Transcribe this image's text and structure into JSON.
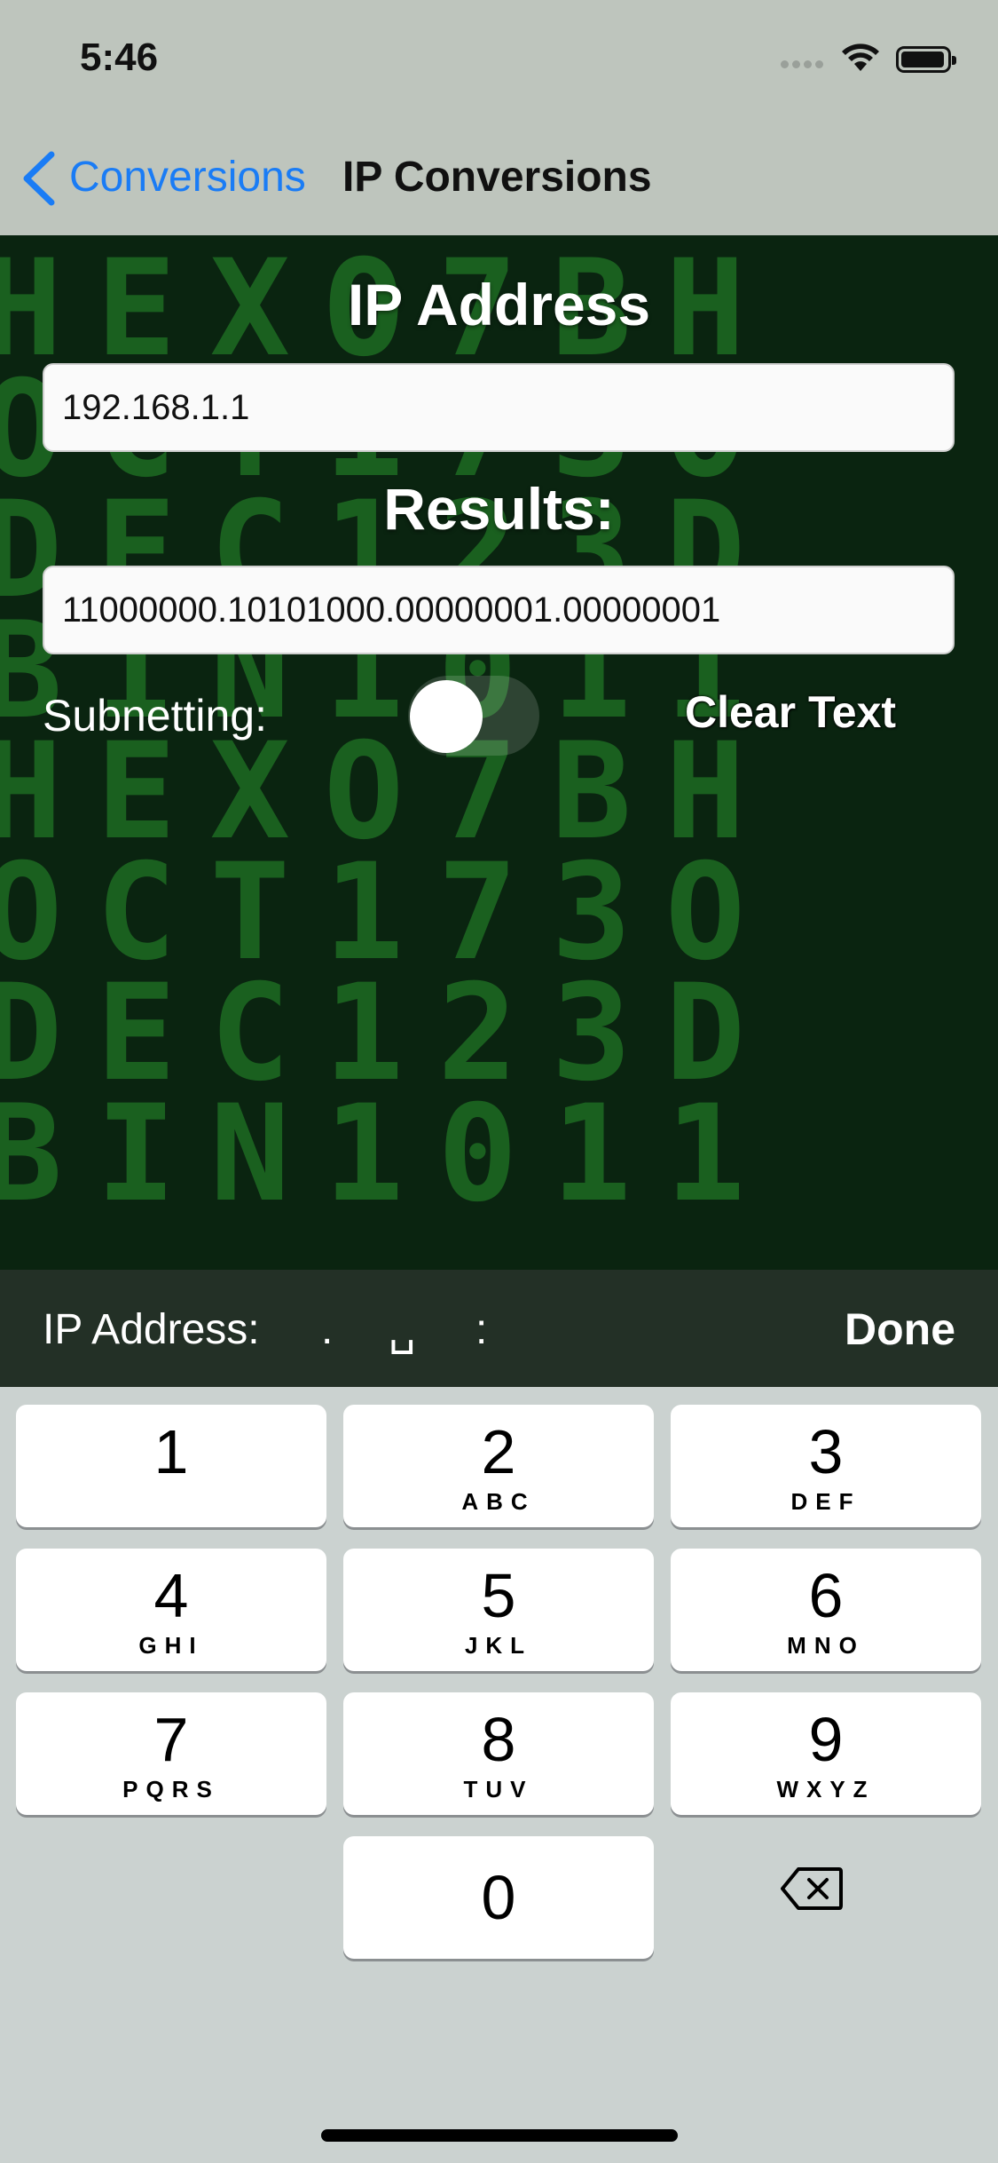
{
  "status": {
    "time": "5:46"
  },
  "nav": {
    "back_label": "Conversions",
    "title": "IP Conversions"
  },
  "background_text": [
    "HEXO7BH",
    "OCT173O",
    "DEC123D",
    "BIN1011",
    "HEXO7BH",
    "OCT173O",
    "DEC123D",
    "BIN1011"
  ],
  "form": {
    "ip_title": "IP Address",
    "ip_value": "192.168.1.1",
    "results_title": "Results:",
    "results_value": "11000000.10101000.00000001.00000001",
    "subnetting_label": "Subnetting:",
    "subnetting_on": false,
    "clear_label": "Clear Text"
  },
  "accessory": {
    "label": "IP Address:",
    "dot": ".",
    "space": "␣",
    "colon": ":",
    "done": "Done"
  },
  "keypad": {
    "keys": [
      {
        "num": "1",
        "letters": ""
      },
      {
        "num": "2",
        "letters": "ABC"
      },
      {
        "num": "3",
        "letters": "DEF"
      },
      {
        "num": "4",
        "letters": "GHI"
      },
      {
        "num": "5",
        "letters": "JKL"
      },
      {
        "num": "6",
        "letters": "MNO"
      },
      {
        "num": "7",
        "letters": "PQRS"
      },
      {
        "num": "8",
        "letters": "TUV"
      },
      {
        "num": "9",
        "letters": "WXYZ"
      },
      {
        "num": "0",
        "letters": ""
      }
    ]
  },
  "icons": {
    "back": "chevron-left-icon",
    "wifi": "wifi-icon",
    "battery": "battery-icon",
    "delete": "delete-backspace-icon"
  },
  "colors": {
    "accent": "#1a7cf5",
    "matrix_green": "#1d6b22",
    "hero_bg": "#0a2410"
  }
}
